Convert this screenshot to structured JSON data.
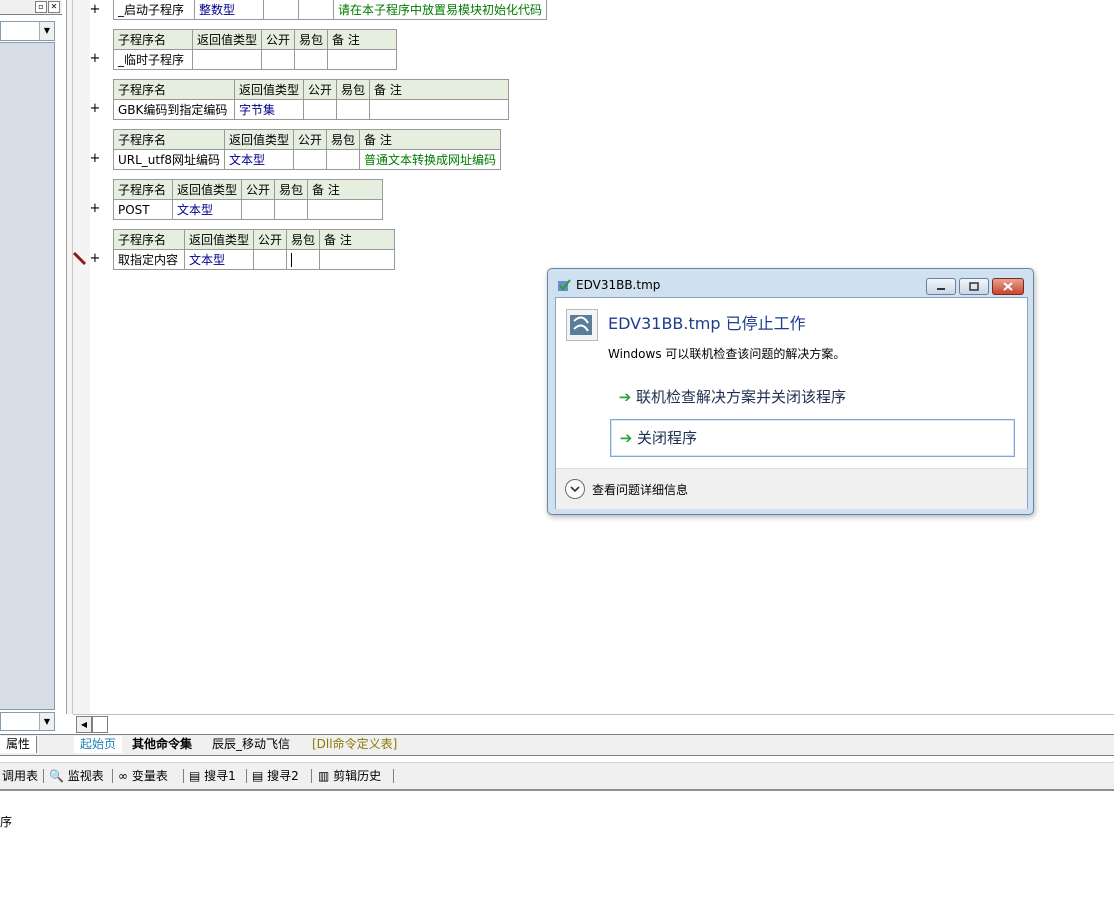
{
  "left_panel": {
    "properties_tab": "属性"
  },
  "editor": {
    "first_row": {
      "name": "_启动子程序",
      "type": "整数型",
      "note": "请在本子程序中放置易模块初始化代码"
    },
    "header": {
      "name": "子程序名",
      "ret": "返回值类型",
      "public": "公开",
      "easy": "易包",
      "note": "备 注"
    },
    "subs": [
      {
        "name": "_临时子程序",
        "type": "",
        "note": ""
      },
      {
        "name": "GBK编码到指定编码",
        "type": "字节集",
        "note": ""
      },
      {
        "name": "URL_utf8网址编码",
        "type": "文本型",
        "note": "普通文本转换成网址编码"
      },
      {
        "name": "POST",
        "type": "文本型",
        "note": ""
      },
      {
        "name": "取指定内容",
        "type": "文本型",
        "note": ""
      }
    ],
    "plus": "+"
  },
  "tabs": [
    "起始页",
    "其他命令集",
    "辰辰_移动飞信",
    "[Dll命令定义表]"
  ],
  "toolbar": [
    "调用表",
    "监视表",
    "变量表",
    "搜寻1",
    "搜寻2",
    "剪辑历史"
  ],
  "status": {
    "fragment": "序"
  },
  "dialog": {
    "title": "EDV31BB.tmp",
    "heading": "EDV31BB.tmp 已停止工作",
    "subtext": "Windows 可以联机检查该问题的解决方案。",
    "option1": "联机检查解决方案并关闭该程序",
    "option2": "关闭程序",
    "details": "查看问题详细信息"
  }
}
